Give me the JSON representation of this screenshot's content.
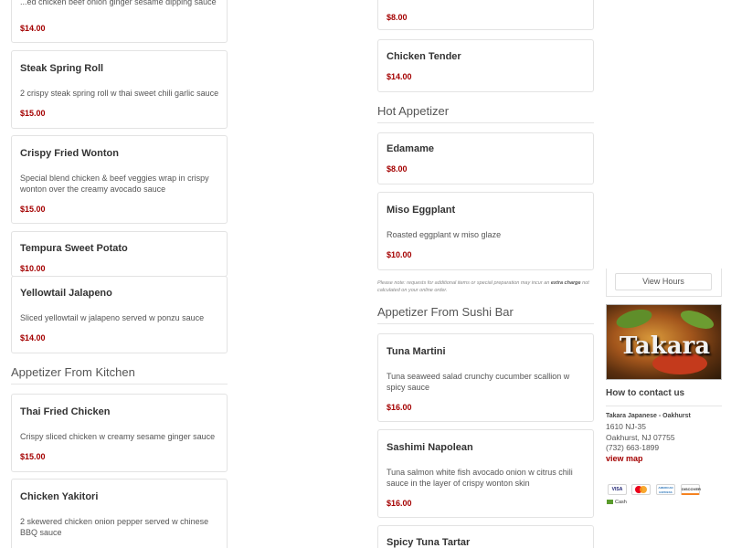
{
  "left_column": {
    "top_partial_card": {
      "desc": "...ed chicken beef onion ginger sesame dipping sauce",
      "price": "$14.00"
    },
    "items": [
      {
        "name": "Steak Spring Roll",
        "desc": "2 crispy steak spring roll w thai sweet chili garlic sauce",
        "price": "$15.00"
      },
      {
        "name": "Crispy Fried Wonton",
        "desc": "Special blend chicken & beef veggies wrap in crispy wonton over the creamy avocado sauce",
        "price": "$15.00"
      },
      {
        "name": "Tempura Sweet Potato",
        "desc": "",
        "price": "$10.00"
      },
      {
        "name": "Yellowtail Jalapeno",
        "desc": "Sliced yellowtail w jalapeno served w ponzu sauce",
        "price": "$14.00"
      }
    ],
    "section_kitchen": {
      "title": "Appetizer From Kitchen",
      "items": [
        {
          "name": "Thai Fried Chicken",
          "desc": "Crispy sliced chicken w creamy sesame ginger sauce",
          "price": "$15.00"
        },
        {
          "name": "Chicken Yakitori",
          "desc": "2 skewered chicken onion pepper served w chinese BBQ sauce",
          "price": ""
        }
      ]
    }
  },
  "mid_column": {
    "top_partial_card": {
      "price": "$8.00"
    },
    "chicken_tender": {
      "name": "Chicken Tender",
      "price": "$14.00"
    },
    "section_hot": {
      "title": "Hot Appetizer",
      "items": [
        {
          "name": "Edamame",
          "desc": "",
          "price": "$8.00"
        },
        {
          "name": "Miso Eggplant",
          "desc": "Roasted eggplant w miso glaze",
          "price": "$10.00"
        }
      ]
    },
    "note": {
      "text": "Please note: requests for additional items or special preparation may incur an",
      "bold": "extra charge",
      "tail": "not calculated on your online order."
    },
    "section_sushi": {
      "title": "Appetizer From Sushi Bar",
      "items": [
        {
          "name": "Tuna Martini",
          "desc": "Tuna seaweed salad crunchy cucumber scallion w spicy sauce",
          "price": "$16.00"
        },
        {
          "name": "Sashimi Napolean",
          "desc": "Tuna salmon white fish avocado onion w citrus chili sauce in the layer of crispy wonton skin",
          "price": "$16.00"
        },
        {
          "name": "Spicy Tuna Tartar",
          "desc": "",
          "price": ""
        }
      ]
    }
  },
  "sidebar": {
    "view_hours": "View Hours",
    "logo_text": "Takara",
    "contact": {
      "title": "How to contact us",
      "name": "Takara Japanese - Oakhurst",
      "address1": "1610 NJ-35",
      "address2": "Oakhurst, NJ 07755",
      "phone": "(732) 663-1899",
      "map_link": "view map"
    },
    "payments": {
      "visa": "VISA",
      "mastercard": "",
      "amex": "AMERICAN EXPRESS",
      "discover": "DISCOVER",
      "cash": "Cash"
    }
  },
  "colors": {
    "price": "#a40000",
    "card_border": "#e3e3e3",
    "section_title": "#555555"
  }
}
